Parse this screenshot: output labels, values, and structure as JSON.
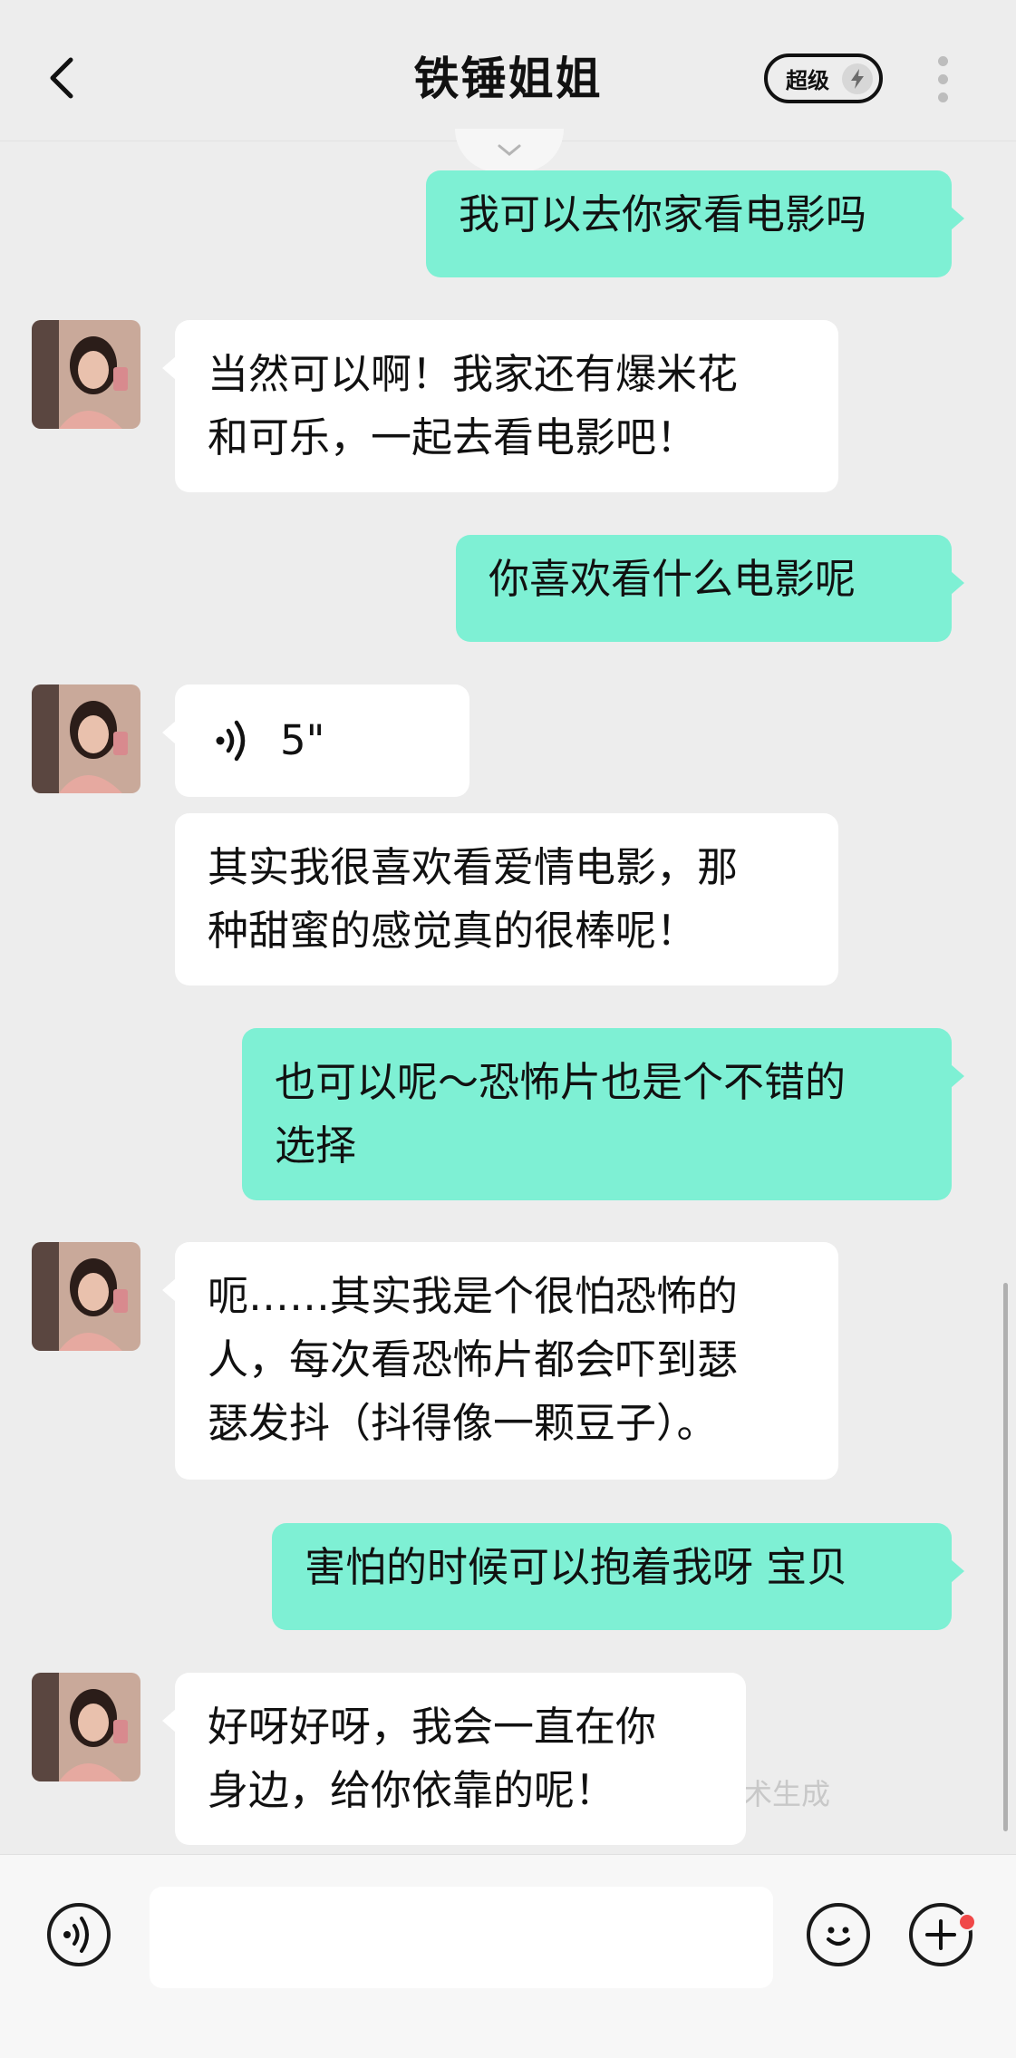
{
  "header": {
    "title": "铁锤姐姐",
    "badge_label": "超级",
    "back_icon": "chevron-left-icon",
    "more_icon": "more-vertical-icon",
    "badge_icon": "lightning-icon"
  },
  "messages": [
    {
      "from": "me",
      "lines": [
        "我可以去你家看电影吗"
      ]
    },
    {
      "from": "them",
      "lines": [
        "当然可以啊！我家还有爆米花",
        "和可乐，一起去看电影吧！"
      ]
    },
    {
      "from": "me",
      "lines": [
        "你喜欢看什么电影呢"
      ]
    },
    {
      "from": "them",
      "type": "voice",
      "duration": "5\""
    },
    {
      "from": "them",
      "lines": [
        "其实我很喜欢看爱情电影，那",
        "种甜蜜的感觉真的很棒呢！"
      ]
    },
    {
      "from": "me",
      "lines": [
        "也可以呢～恐怖片也是个不错的",
        "选择"
      ]
    },
    {
      "from": "them",
      "lines": [
        "呃……其实我是个很怕恐怖的",
        "人，每次看恐怖片都会吓到瑟",
        "瑟发抖（抖得像一颗豆子）。"
      ]
    },
    {
      "from": "me",
      "lines": [
        "害怕的时候可以抱着我呀 宝贝"
      ]
    },
    {
      "from": "them",
      "lines": [
        "好呀好呀，我会一直在你",
        "身边，给你依靠的呢！"
      ]
    }
  ],
  "watermark": "术生成",
  "bottom_bar": {
    "voice_icon": "voice-input-icon",
    "emoji_icon": "smiley-icon",
    "plus_icon": "plus-icon",
    "input_value": ""
  },
  "colors": {
    "my_bubble": "#7ef0d4",
    "their_bubble": "#ffffff",
    "background": "#ededed",
    "notification_dot": "#f04848"
  }
}
